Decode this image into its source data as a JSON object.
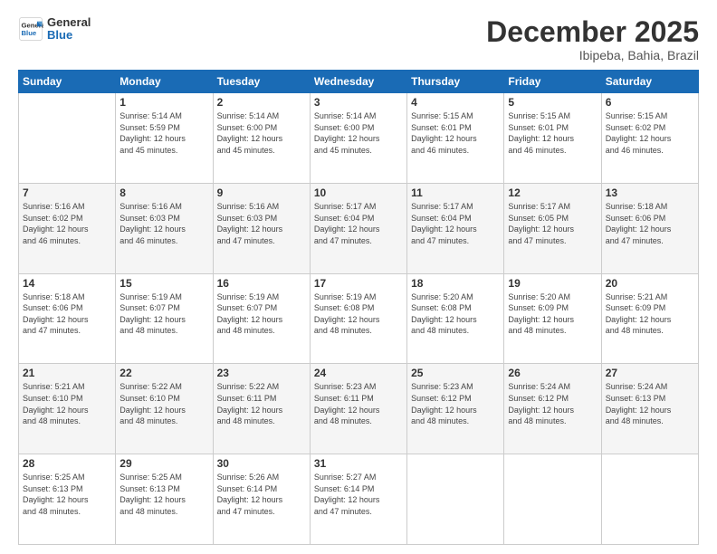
{
  "logo": {
    "line1": "General",
    "line2": "Blue"
  },
  "header": {
    "month": "December 2025",
    "location": "Ibipeba, Bahia, Brazil"
  },
  "days_of_week": [
    "Sunday",
    "Monday",
    "Tuesday",
    "Wednesday",
    "Thursday",
    "Friday",
    "Saturday"
  ],
  "weeks": [
    [
      {
        "day": "",
        "info": ""
      },
      {
        "day": "1",
        "info": "Sunrise: 5:14 AM\nSunset: 5:59 PM\nDaylight: 12 hours\nand 45 minutes."
      },
      {
        "day": "2",
        "info": "Sunrise: 5:14 AM\nSunset: 6:00 PM\nDaylight: 12 hours\nand 45 minutes."
      },
      {
        "day": "3",
        "info": "Sunrise: 5:14 AM\nSunset: 6:00 PM\nDaylight: 12 hours\nand 45 minutes."
      },
      {
        "day": "4",
        "info": "Sunrise: 5:15 AM\nSunset: 6:01 PM\nDaylight: 12 hours\nand 46 minutes."
      },
      {
        "day": "5",
        "info": "Sunrise: 5:15 AM\nSunset: 6:01 PM\nDaylight: 12 hours\nand 46 minutes."
      },
      {
        "day": "6",
        "info": "Sunrise: 5:15 AM\nSunset: 6:02 PM\nDaylight: 12 hours\nand 46 minutes."
      }
    ],
    [
      {
        "day": "7",
        "info": "Sunrise: 5:16 AM\nSunset: 6:02 PM\nDaylight: 12 hours\nand 46 minutes."
      },
      {
        "day": "8",
        "info": "Sunrise: 5:16 AM\nSunset: 6:03 PM\nDaylight: 12 hours\nand 46 minutes."
      },
      {
        "day": "9",
        "info": "Sunrise: 5:16 AM\nSunset: 6:03 PM\nDaylight: 12 hours\nand 47 minutes."
      },
      {
        "day": "10",
        "info": "Sunrise: 5:17 AM\nSunset: 6:04 PM\nDaylight: 12 hours\nand 47 minutes."
      },
      {
        "day": "11",
        "info": "Sunrise: 5:17 AM\nSunset: 6:04 PM\nDaylight: 12 hours\nand 47 minutes."
      },
      {
        "day": "12",
        "info": "Sunrise: 5:17 AM\nSunset: 6:05 PM\nDaylight: 12 hours\nand 47 minutes."
      },
      {
        "day": "13",
        "info": "Sunrise: 5:18 AM\nSunset: 6:06 PM\nDaylight: 12 hours\nand 47 minutes."
      }
    ],
    [
      {
        "day": "14",
        "info": "Sunrise: 5:18 AM\nSunset: 6:06 PM\nDaylight: 12 hours\nand 47 minutes."
      },
      {
        "day": "15",
        "info": "Sunrise: 5:19 AM\nSunset: 6:07 PM\nDaylight: 12 hours\nand 48 minutes."
      },
      {
        "day": "16",
        "info": "Sunrise: 5:19 AM\nSunset: 6:07 PM\nDaylight: 12 hours\nand 48 minutes."
      },
      {
        "day": "17",
        "info": "Sunrise: 5:19 AM\nSunset: 6:08 PM\nDaylight: 12 hours\nand 48 minutes."
      },
      {
        "day": "18",
        "info": "Sunrise: 5:20 AM\nSunset: 6:08 PM\nDaylight: 12 hours\nand 48 minutes."
      },
      {
        "day": "19",
        "info": "Sunrise: 5:20 AM\nSunset: 6:09 PM\nDaylight: 12 hours\nand 48 minutes."
      },
      {
        "day": "20",
        "info": "Sunrise: 5:21 AM\nSunset: 6:09 PM\nDaylight: 12 hours\nand 48 minutes."
      }
    ],
    [
      {
        "day": "21",
        "info": "Sunrise: 5:21 AM\nSunset: 6:10 PM\nDaylight: 12 hours\nand 48 minutes."
      },
      {
        "day": "22",
        "info": "Sunrise: 5:22 AM\nSunset: 6:10 PM\nDaylight: 12 hours\nand 48 minutes."
      },
      {
        "day": "23",
        "info": "Sunrise: 5:22 AM\nSunset: 6:11 PM\nDaylight: 12 hours\nand 48 minutes."
      },
      {
        "day": "24",
        "info": "Sunrise: 5:23 AM\nSunset: 6:11 PM\nDaylight: 12 hours\nand 48 minutes."
      },
      {
        "day": "25",
        "info": "Sunrise: 5:23 AM\nSunset: 6:12 PM\nDaylight: 12 hours\nand 48 minutes."
      },
      {
        "day": "26",
        "info": "Sunrise: 5:24 AM\nSunset: 6:12 PM\nDaylight: 12 hours\nand 48 minutes."
      },
      {
        "day": "27",
        "info": "Sunrise: 5:24 AM\nSunset: 6:13 PM\nDaylight: 12 hours\nand 48 minutes."
      }
    ],
    [
      {
        "day": "28",
        "info": "Sunrise: 5:25 AM\nSunset: 6:13 PM\nDaylight: 12 hours\nand 48 minutes."
      },
      {
        "day": "29",
        "info": "Sunrise: 5:25 AM\nSunset: 6:13 PM\nDaylight: 12 hours\nand 48 minutes."
      },
      {
        "day": "30",
        "info": "Sunrise: 5:26 AM\nSunset: 6:14 PM\nDaylight: 12 hours\nand 47 minutes."
      },
      {
        "day": "31",
        "info": "Sunrise: 5:27 AM\nSunset: 6:14 PM\nDaylight: 12 hours\nand 47 minutes."
      },
      {
        "day": "",
        "info": ""
      },
      {
        "day": "",
        "info": ""
      },
      {
        "day": "",
        "info": ""
      }
    ]
  ]
}
